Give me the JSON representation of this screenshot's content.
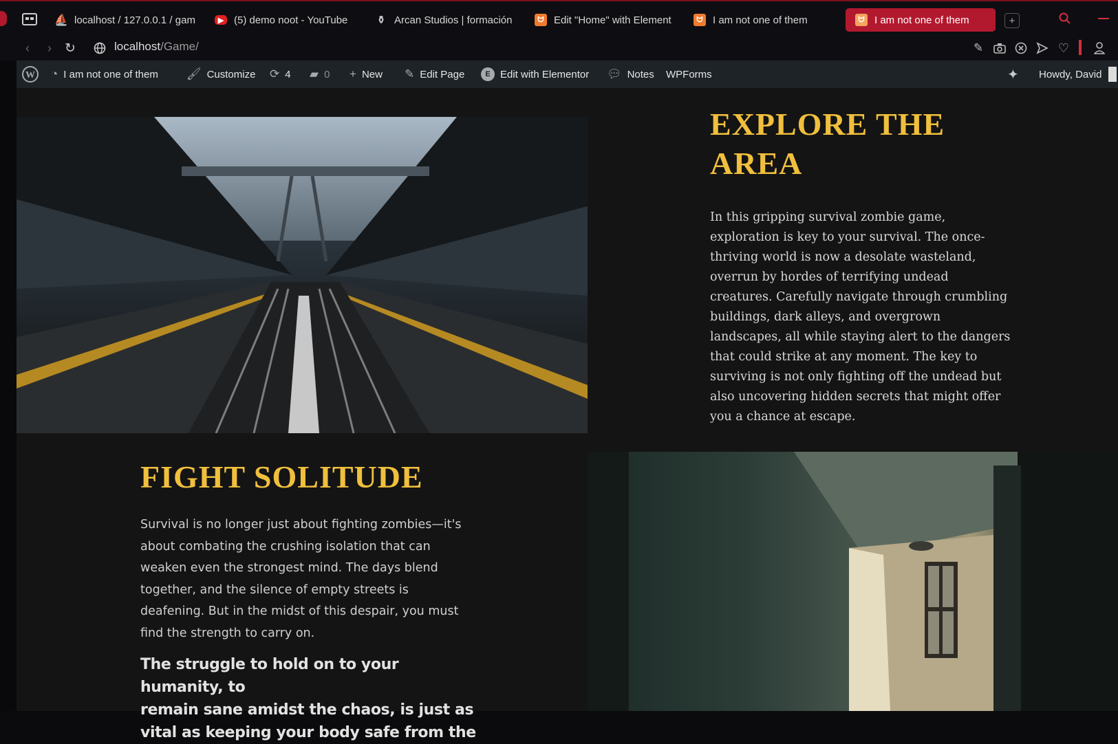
{
  "browser": {
    "tabs": [
      {
        "label": "",
        "icon": "window-icon"
      },
      {
        "label": "localhost / 127.0.0.1 / gam",
        "icon": "phpmyadmin-icon"
      },
      {
        "label": "(5) demo noot - YouTube",
        "icon": "youtube-icon"
      },
      {
        "label": "Arcan Studios | formación",
        "icon": "arcan-icon"
      },
      {
        "label": "Edit \"Home\" with Element",
        "icon": "elementor-icon"
      },
      {
        "label": "I am not one of them",
        "icon": "elementor-icon"
      },
      {
        "label": "I am not one of them",
        "icon": "elementor-icon",
        "active": true
      }
    ],
    "url_host": "localhost",
    "url_path": "/Game/",
    "accent_color": "#b3192e"
  },
  "wp_admin_bar": {
    "site_name": "I am not one of them",
    "customize": "Customize",
    "updates_count": "4",
    "comments_count": "0",
    "new": "New",
    "edit_page": "Edit Page",
    "edit_elementor": "Edit with Elementor",
    "notes": "Notes",
    "wpforms": "WPForms",
    "howdy": "Howdy, David"
  },
  "sections": {
    "explore": {
      "title_line1": "EXPLORE THE",
      "title_line2": "AREA",
      "lines": [
        "In this gripping survival zombie game,",
        "exploration is key to your survival. The once-",
        "thriving world is now a desolate wasteland,",
        "overrun by hordes of terrifying undead",
        "creatures. Carefully navigate through crumbling",
        "buildings, dark alleys, and overgrown",
        "landscapes, all while staying alert to the dangers",
        "that could strike at any moment. The key to",
        "surviving is not only fighting off the undead but",
        "also uncovering hidden secrets that might offer",
        "you a chance at escape."
      ]
    },
    "fight": {
      "title": "FIGHT SOLITUDE",
      "lines": [
        "Survival is no longer just about fighting zombies—it's",
        "about combating the crushing isolation that can",
        "weaken even the strongest mind. The days blend",
        "together, and the silence of empty streets is",
        "deafening. But in the midst of this despair, you must",
        "find the strength to carry on."
      ],
      "quote_lines": [
        "The struggle to hold on to your humanity, to",
        "remain sane amidst the chaos, is just as",
        "vital as keeping your body safe from the"
      ]
    }
  },
  "colors": {
    "heading": "#f0bf3d",
    "page_bg": "#141414",
    "admin_bar": "#1d2327"
  }
}
